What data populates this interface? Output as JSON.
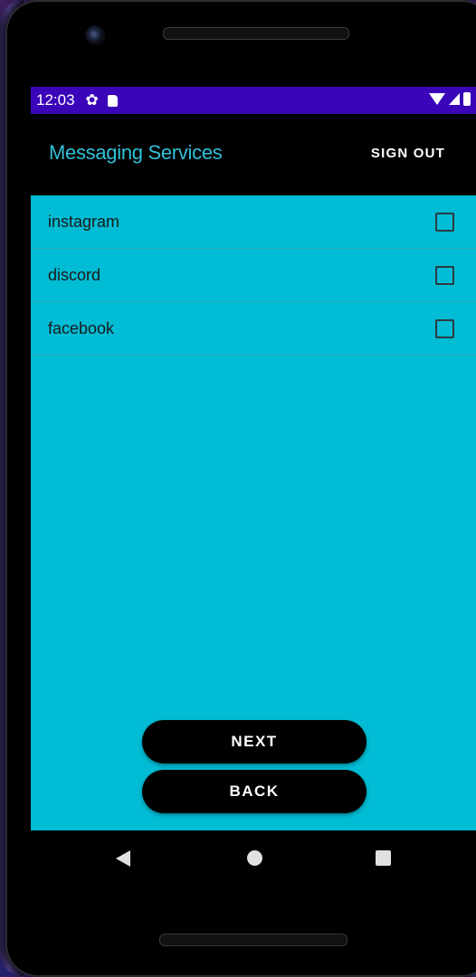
{
  "status_bar": {
    "time": "12:03",
    "icons": [
      "gear-icon",
      "sd-card-icon",
      "wifi-icon",
      "cell-signal-icon",
      "battery-icon"
    ]
  },
  "app_bar": {
    "title": "Messaging Services",
    "sign_out_label": "SIGN OUT"
  },
  "services": [
    {
      "label": "instagram",
      "checked": false
    },
    {
      "label": "discord",
      "checked": false
    },
    {
      "label": "facebook",
      "checked": false
    }
  ],
  "actions": {
    "next_label": "NEXT",
    "back_label": "BACK"
  },
  "nav_bar": {
    "icons": [
      "back-triangle-icon",
      "home-circle-icon",
      "recents-square-icon"
    ]
  },
  "colors": {
    "status_bar": "#3a05b8",
    "title_accent": "#30c0d8",
    "content_background": "#00bcd4",
    "button_background": "#000000"
  }
}
